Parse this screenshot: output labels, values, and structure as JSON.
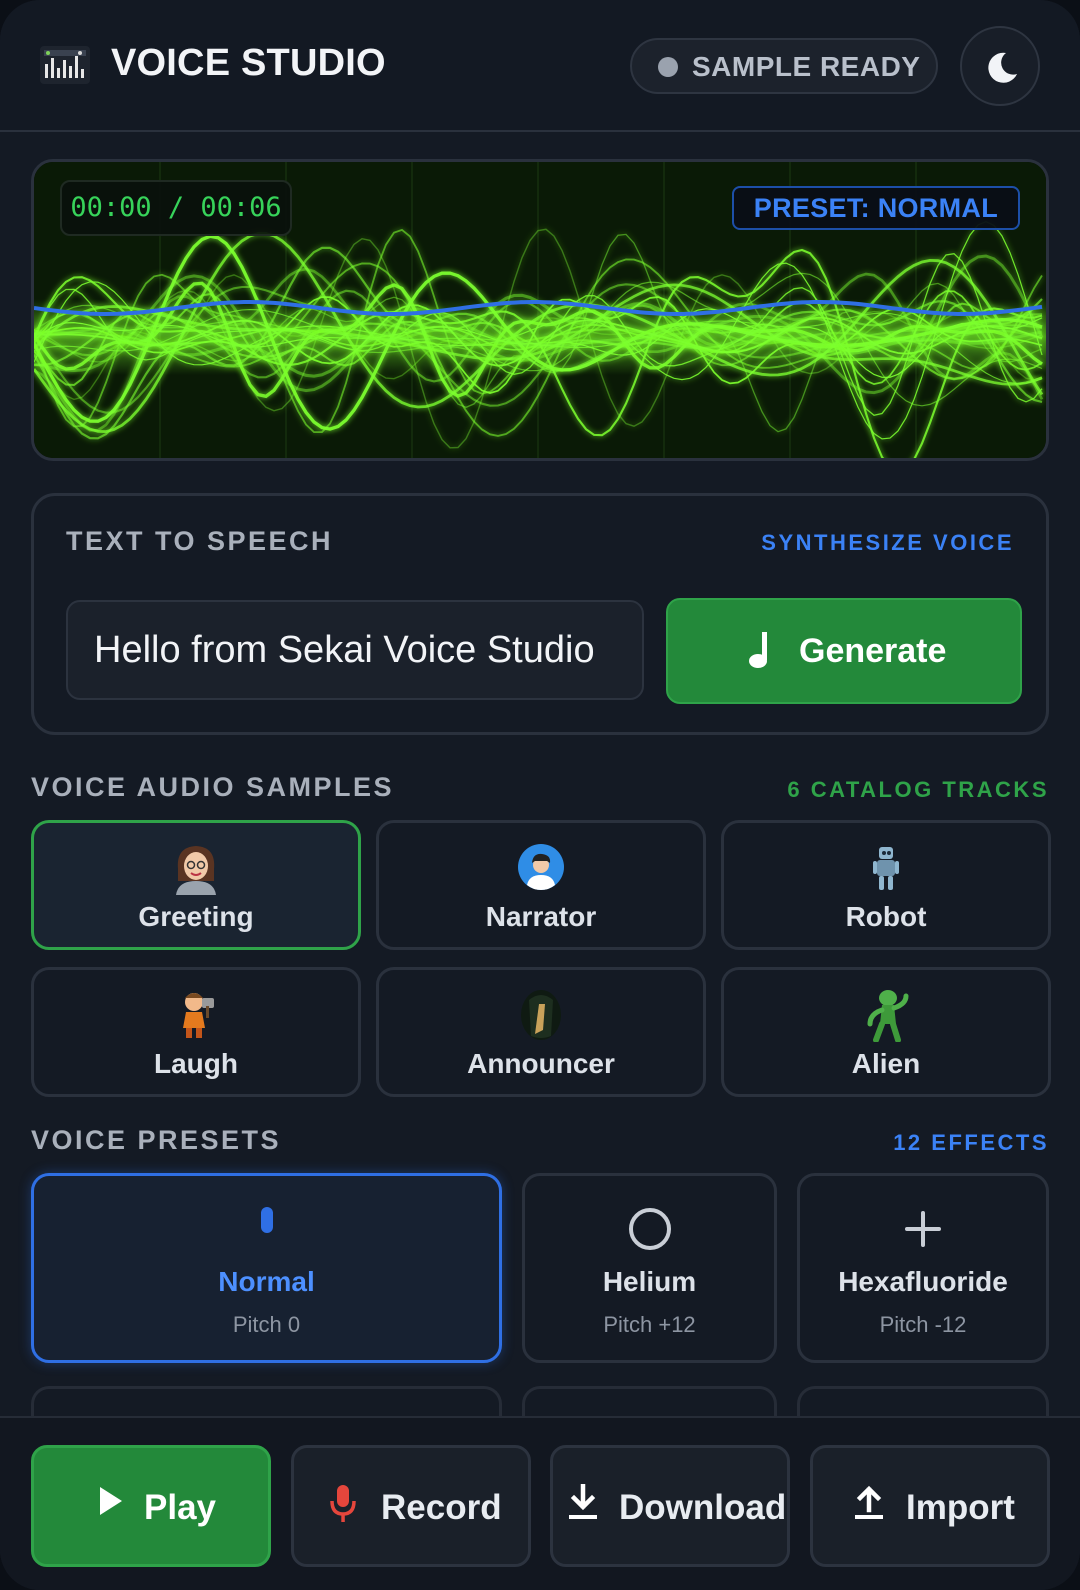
{
  "header": {
    "app_title": "VOICE STUDIO",
    "status_text": "SAMPLE READY",
    "logo_icon": "mixer-board-icon",
    "theme_icon": "moon-icon"
  },
  "visualizer": {
    "time_display": "00:00 / 00:06",
    "preset_badge": "PRESET: NORMAL",
    "wave_color": "#7cff2e",
    "pitch_line_color": "#2f6fe4"
  },
  "tts": {
    "title": "TEXT TO SPEECH",
    "subtitle": "SYNTHESIZE VOICE",
    "input_value": "Hello from Sekai Voice Studio",
    "generate_label": "Generate",
    "generate_icon": "music-note-icon"
  },
  "samples": {
    "title": "VOICE AUDIO SAMPLES",
    "meta": "6 CATALOG TRACKS",
    "items": [
      {
        "label": "Greeting",
        "icon": "woman-avatar-icon",
        "selected": true
      },
      {
        "label": "Narrator",
        "icon": "person-avatar-icon",
        "selected": false
      },
      {
        "label": "Robot",
        "icon": "robot-icon",
        "selected": false
      },
      {
        "label": "Laugh",
        "icon": "character-laugh-icon",
        "selected": false
      },
      {
        "label": "Announcer",
        "icon": "announcer-icon",
        "selected": false
      },
      {
        "label": "Alien",
        "icon": "alien-icon",
        "selected": false
      }
    ]
  },
  "presets": {
    "title": "VOICE PRESETS",
    "meta": "12 EFFECTS",
    "items": [
      {
        "name": "Normal",
        "pitch": "Pitch 0",
        "icon": "pill-icon",
        "selected": true
      },
      {
        "name": "Helium",
        "pitch": "Pitch +12",
        "icon": "circle-icon",
        "selected": false
      },
      {
        "name": "Hexafluoride",
        "pitch": "Pitch -12",
        "icon": "plus-icon",
        "selected": false
      }
    ]
  },
  "actions": {
    "play": "Play",
    "record": "Record",
    "download": "Download",
    "import": "Import"
  },
  "colors": {
    "accent_green": "#23893a",
    "accent_blue": "#3b82f6",
    "meta_green": "#2fa349",
    "background": "#141a24"
  }
}
